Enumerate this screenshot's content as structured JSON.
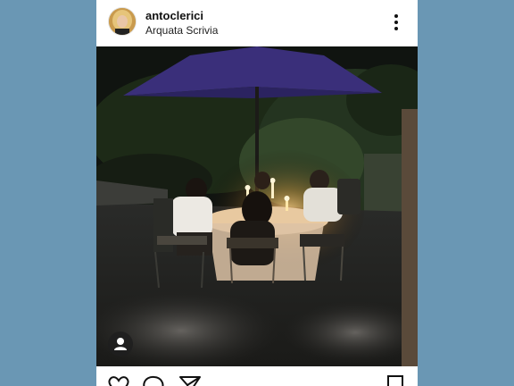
{
  "post": {
    "username": "antoclerici",
    "location": "Arquata Scrivia"
  },
  "icons": {
    "avatar": "profile-photo",
    "more": "vertical-ellipsis-icon",
    "tag": "person-tag-icon",
    "like": "heart-icon",
    "comment": "speech-bubble-icon",
    "share": "paper-plane-icon",
    "save": "bookmark-icon"
  },
  "colors": {
    "background": "#6a97b4",
    "card": "#ffffff",
    "umbrella": "#3a2f7a",
    "candle_glow": "#ffd28a"
  }
}
